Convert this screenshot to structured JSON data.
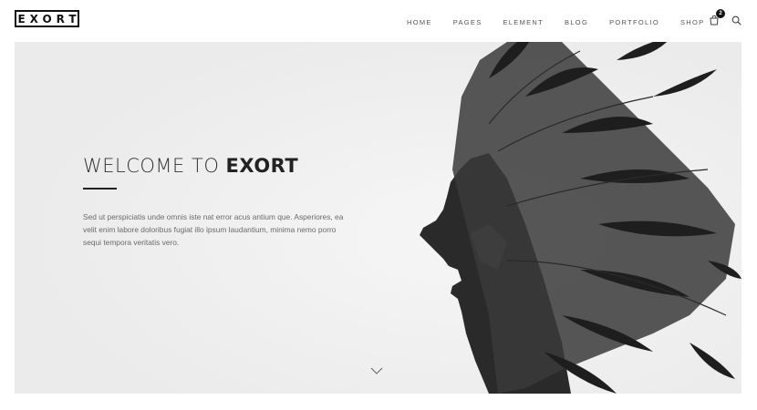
{
  "header": {
    "logo_text": "EXORT",
    "nav": [
      "HOME",
      "PAGES",
      "ELEMENT",
      "BLOG",
      "PORTFOLIO",
      "SHOP"
    ],
    "cart_count": "2",
    "cart_icon": "shopping-bag-icon",
    "search_icon": "search-icon"
  },
  "hero": {
    "title_light": "WELCOME TO ",
    "title_bold": "EXORT",
    "description": "Sed ut perspiciatis unde omnis iste nat error acus antium que. Asperiores, ea velit enim labore doloribus fugiat illo ipsum laudantium, minima nemo porro sequi tempora veritatis vero.",
    "scroll_icon": "chevron-down-icon"
  },
  "colors": {
    "hero_background": "#ebebeb",
    "text_dark": "#222222",
    "text_body": "#6a6a6a"
  }
}
